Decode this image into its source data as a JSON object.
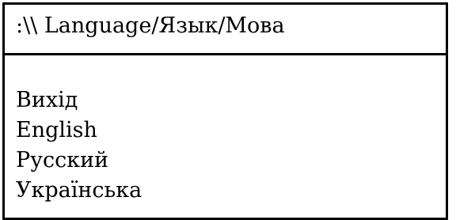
{
  "window": {
    "title": ":\\\\ Language/Язык/Мова"
  },
  "menu": {
    "items": [
      {
        "label": "Вихід"
      },
      {
        "label": "English"
      },
      {
        "label": "Русский"
      },
      {
        "label": "Українська"
      }
    ]
  }
}
